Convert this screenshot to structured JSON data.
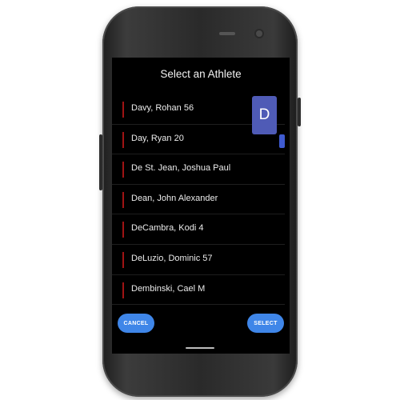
{
  "dialog": {
    "title": "Select an Athlete",
    "athletes": [
      "Davy, Rohan 56",
      "Day, Ryan 20",
      "De St. Jean, Joshua Paul",
      "Dean, John Alexander",
      "DeCambra, Kodi 4",
      "DeLuzio, Dominic 57",
      "Dembinski, Cael M"
    ],
    "index_letter": "D",
    "cancel_label": "CANCEL",
    "select_label": "SELECT"
  },
  "colors": {
    "accent": "#3f86e8",
    "index_bubble": "#4f5bb6",
    "row_marker": "#a01414"
  }
}
